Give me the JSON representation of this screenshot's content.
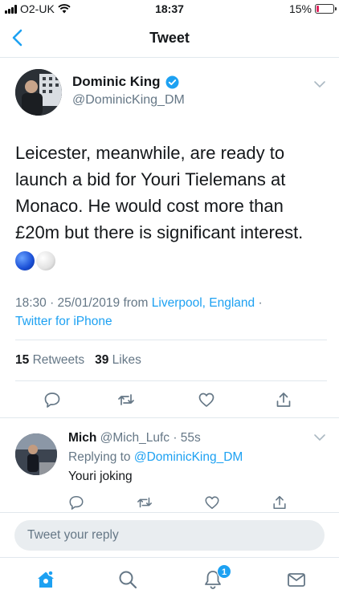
{
  "status_bar": {
    "carrier": "O2-UK",
    "time": "18:37",
    "battery_percent": "15%",
    "battery_level": 0.15,
    "battery_color": "#e0245e"
  },
  "header": {
    "title": "Tweet",
    "back_icon": "chevron-left-icon"
  },
  "tweet": {
    "author_name": "Dominic King",
    "author_handle": "@DominicKing_DM",
    "verified": true,
    "text": "Leicester, meanwhile, are ready to launch a bid for Youri Tielemans at Monaco. He would cost more than £20m but there is significant interest.",
    "emoji": [
      "blue-circle",
      "white-circle"
    ],
    "timestamp": "18:30 · 25/01/2019 from ",
    "location": "Liverpool, England",
    "location_sep": " ·",
    "source": "Twitter for iPhone",
    "retweets_count": "15",
    "retweets_label": "Retweets",
    "likes_count": "39",
    "likes_label": "Likes"
  },
  "reply": {
    "author_name": "Mich",
    "author_handle": "@Mich_Lufc",
    "age": "· 55s",
    "replying_label": "Replying to ",
    "replying_handle": "@DominicKing_DM",
    "text": "Youri joking"
  },
  "compose": {
    "placeholder": "Tweet your reply"
  },
  "tabbar": {
    "items": [
      "home-icon",
      "search-icon",
      "notifications-icon",
      "messages-icon"
    ],
    "notifications_badge": "1"
  },
  "colors": {
    "accent": "#1da1f2",
    "text": "#14171a",
    "secondary": "#657786",
    "divider": "#e1e8ed"
  }
}
